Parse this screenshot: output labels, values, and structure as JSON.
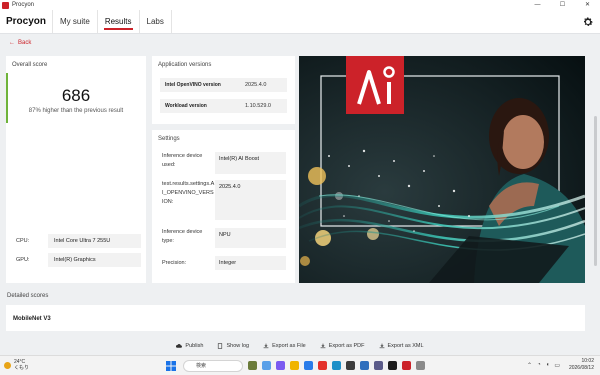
{
  "window": {
    "title": "Procyon",
    "controls": [
      "—",
      "☐",
      "✕"
    ]
  },
  "header": {
    "brand": "Procyon",
    "tabs": [
      {
        "label": "My suite",
        "active": false
      },
      {
        "label": "Results",
        "active": true
      },
      {
        "label": "Labs",
        "active": false
      }
    ],
    "settings_icon": "gear-icon"
  },
  "back_label": "Back",
  "overall": {
    "title": "Overall score",
    "score": "686",
    "comparison": "87% higher than the previous result",
    "cpu_label": "CPU:",
    "cpu_value": "Intel Core Ultra 7 255U",
    "gpu_label": "GPU:",
    "gpu_value": "Intel(R) Graphics",
    "accent_color": "#6fb33a"
  },
  "versions": {
    "title": "Application versions",
    "rows": [
      {
        "key": "Intel OpenVINO version",
        "value": "2025.4.0"
      },
      {
        "key": "Workload version",
        "value": "1.10.529.0"
      }
    ]
  },
  "settings": {
    "title": "Settings",
    "rows": [
      {
        "key": "Inference device used:",
        "value": "Intel(R) AI Boost"
      },
      {
        "key": "test.results.settings.AI_OPENVINO_VERSION:",
        "value": "2025.4.0"
      },
      {
        "key": "Inference device type:",
        "value": "NPU"
      },
      {
        "key": "Precision:",
        "value": "Integer"
      }
    ]
  },
  "detailed": {
    "title": "Detailed scores",
    "first_item": "MobileNet V3"
  },
  "actions": [
    {
      "label": "Publish",
      "icon": "cloud-upload-icon"
    },
    {
      "label": "Show log",
      "icon": "document-icon"
    },
    {
      "label": "Export as File",
      "icon": "download-icon"
    },
    {
      "label": "Export as PDF",
      "icon": "download-icon"
    },
    {
      "label": "Export as XML",
      "icon": "download-icon"
    }
  ],
  "taskbar": {
    "temperature": "24°C",
    "weather_desc": "くもり",
    "search_placeholder": "検索",
    "time": "10:02",
    "date": "2026/08/12"
  },
  "colors": {
    "brand_red": "#cc2229",
    "teal": "#2aa59a"
  }
}
